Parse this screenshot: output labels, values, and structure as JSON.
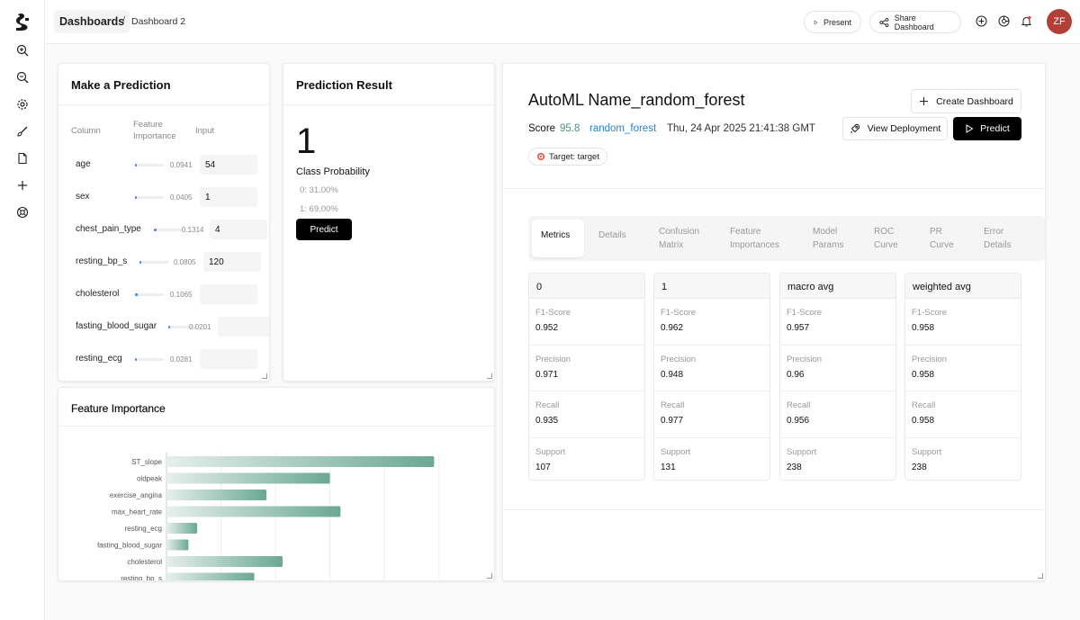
{
  "breadcrumb": {
    "root": "Dashboards",
    "separator": "/",
    "current": "Dashboard 2"
  },
  "header": {
    "present": "Present",
    "share": "Share Dashboard",
    "avatar_initials": "ZF",
    "avatar_color": "#b23f38"
  },
  "sidebar": {
    "items": [
      "zoom-in-icon",
      "zoom-out-icon",
      "settings-icon",
      "brush-icon",
      "document-icon",
      "plus-icon",
      "help-icon"
    ]
  },
  "prediction_form": {
    "title": "Make a Prediction",
    "columns": {
      "column": "Column",
      "importance": "Feature Importance",
      "input": "Input"
    },
    "rows": [
      {
        "name": "age",
        "importance": "0.0941",
        "importance_value": 0.0941,
        "input": "54"
      },
      {
        "name": "sex",
        "importance": "0.0405",
        "importance_value": 0.0405,
        "input": "1"
      },
      {
        "name": "chest_pain_type",
        "importance": "0.1314",
        "importance_value": 0.1314,
        "input": "4"
      },
      {
        "name": "resting_bp_s",
        "importance": "0.0805",
        "importance_value": 0.0805,
        "input": "120"
      },
      {
        "name": "cholesterol",
        "importance": "0.1065",
        "importance_value": 0.1065,
        "input": ""
      },
      {
        "name": "fasting_blood_sugar",
        "importance": "0.0201",
        "importance_value": 0.0201,
        "input": ""
      },
      {
        "name": "resting_ecg",
        "importance": "0.0281",
        "importance_value": 0.0281,
        "input": ""
      }
    ]
  },
  "prediction_result": {
    "title": "Prediction Result",
    "value": "1",
    "class_probability_label": "Class Probability",
    "probabilities": [
      "0: 31.00%",
      "1: 69.00%"
    ],
    "predict_button": "Predict"
  },
  "automl": {
    "title": "AutoML Name_random_forest",
    "score_label": "Score",
    "score_value": "95.8",
    "model_link": "random_forest",
    "timestamp": "Thu, 24 Apr 2025 21:41:38 GMT",
    "target_badge": "Target: target",
    "create_dashboard": "Create Dashboard",
    "view_deployment": "View Deployment",
    "predict": "Predict",
    "score_color": "#3f9a82",
    "link_color": "#2b7fd0",
    "tabs": [
      {
        "line1": "Metrics",
        "line2": ""
      },
      {
        "line1": "Details",
        "line2": ""
      },
      {
        "line1": "Confusion",
        "line2": "Matrix"
      },
      {
        "line1": "Feature",
        "line2": "Importances"
      },
      {
        "line1": "Model",
        "line2": "Params"
      },
      {
        "line1": "ROC",
        "line2": "Curve"
      },
      {
        "line1": "PR",
        "line2": "Curve"
      },
      {
        "line1": "Error",
        "line2": "Details"
      }
    ],
    "metrics": [
      {
        "name": "0",
        "f1": "0.952",
        "precision": "0.971",
        "recall": "0.935",
        "support": "107"
      },
      {
        "name": "1",
        "f1": "0.962",
        "precision": "0.948",
        "recall": "0.977",
        "support": "131"
      },
      {
        "name": "macro avg",
        "f1": "0.957",
        "precision": "0.96",
        "recall": "0.956",
        "support": "238"
      },
      {
        "name": "weighted avg",
        "f1": "0.958",
        "precision": "0.958",
        "recall": "0.958",
        "support": "238"
      }
    ],
    "metric_labels": {
      "f1": "F1-Score",
      "precision": "Precision",
      "recall": "Recall",
      "support": "Support"
    }
  },
  "feature_chart": {
    "title": "Feature Importance"
  },
  "chart_data": {
    "type": "bar",
    "orientation": "horizontal",
    "title": "Feature Importance",
    "categories": [
      "ST_slope",
      "oldpeak",
      "exercise_angina",
      "max_heart_rate",
      "resting_ecg",
      "fasting_blood_sugar",
      "cholesterol",
      "resting_bp_s"
    ],
    "values": [
      0.2455,
      0.1499,
      0.0917,
      0.1596,
      0.0281,
      0.0201,
      0.1065,
      0.0805
    ],
    "xlim": [
      0,
      0.27
    ],
    "grid": true,
    "color_start": "#e6efec",
    "color_end": "#6aa894"
  }
}
